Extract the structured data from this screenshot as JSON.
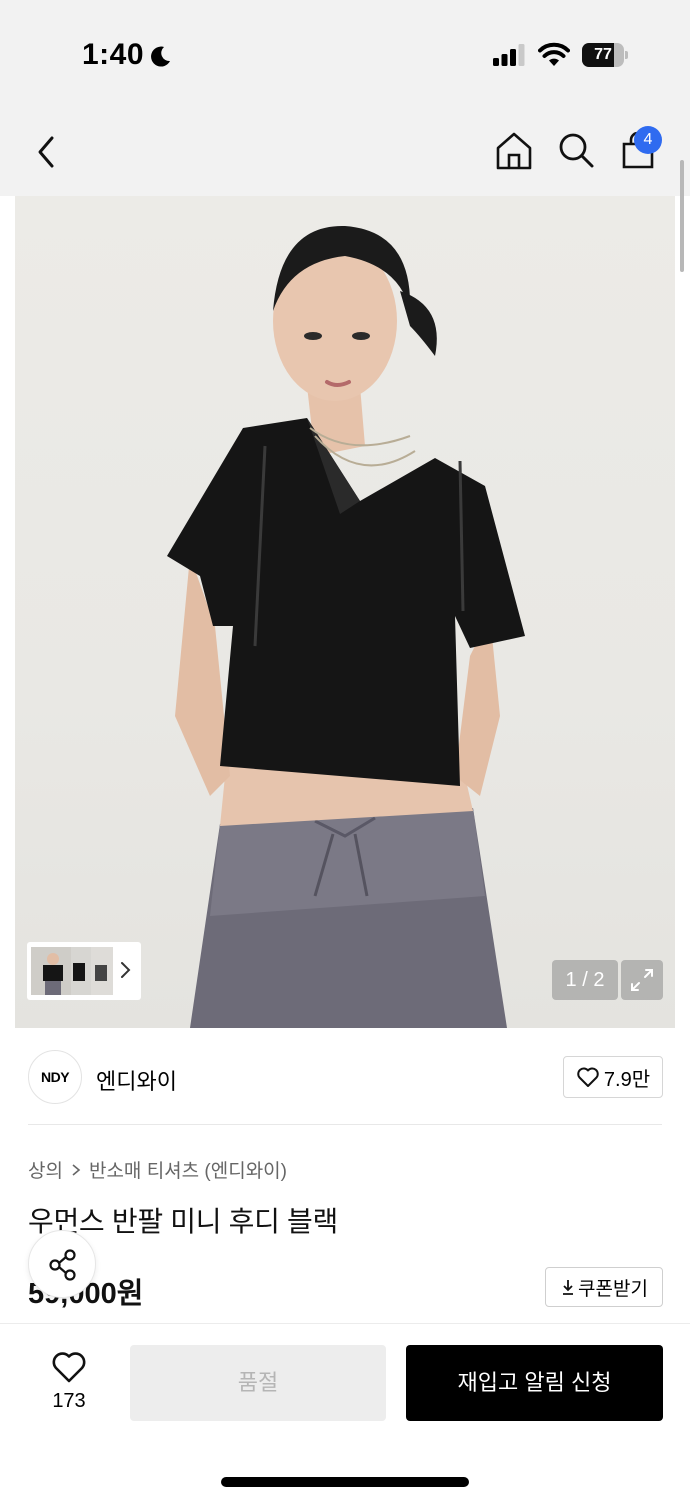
{
  "status_bar": {
    "time": "1:40",
    "battery": "77",
    "battery_level": 0.77
  },
  "header": {
    "cart_count": "4"
  },
  "gallery": {
    "page_indicator": "1 / 2"
  },
  "brand": {
    "logo_text": "NDY",
    "name": "엔디와이",
    "likes": "7.9만"
  },
  "product": {
    "breadcrumb": [
      "상의",
      "반소매 티셔츠 (엔디와이)"
    ],
    "title": "우먼스 반팔 미니 후디 블랙",
    "price": "59,000원",
    "coupon_label": "쿠폰받기"
  },
  "action_bar": {
    "wish_count": "173",
    "soldout_label": "품절",
    "restock_label": "재입고 알림 신청"
  }
}
